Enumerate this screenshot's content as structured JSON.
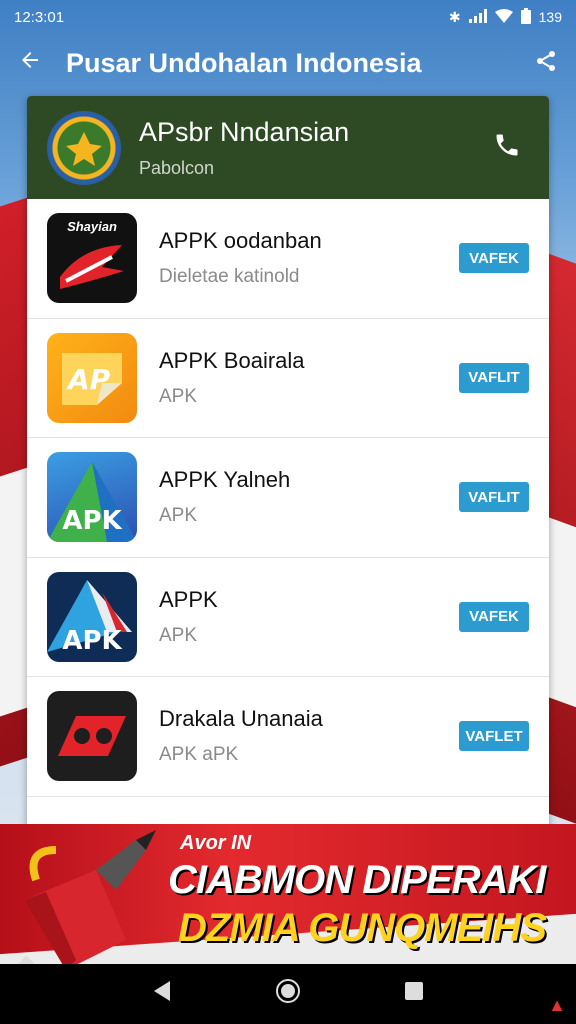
{
  "status_bar": {
    "time": "12:3:01",
    "battery": "139"
  },
  "app_bar": {
    "title": "Pusar Undohalan Indonesia"
  },
  "header": {
    "title": "APsbr Nndansian",
    "subtitle": "Pabolcon"
  },
  "apps": [
    {
      "name": "APPK oodanban",
      "sub": "Dieletae katinold",
      "button": "VAFEK",
      "icon": "logo-red-black",
      "icon_text": "Shayian"
    },
    {
      "name": "APPK Boairala",
      "sub": "APK",
      "button": "VAFLIT",
      "icon": "logo-orange",
      "icon_text": ""
    },
    {
      "name": "APPK Yalneh",
      "sub": "APK",
      "button": "VAFLIT",
      "icon": "logo-blue-apk",
      "icon_text": "APK"
    },
    {
      "name": "APPK",
      "sub": "APK",
      "button": "VAFEK",
      "icon": "logo-navy-apk",
      "icon_text": "APK"
    },
    {
      "name": "Drakala Unanaia",
      "sub": "APK aPK",
      "button": "VAFLET",
      "icon": "logo-black-red",
      "icon_text": ""
    }
  ],
  "banner": {
    "top": "Avor IN",
    "line1": "CIABMON DIPERAKI",
    "line2": "DZMIA GUNQMEIHS"
  },
  "colors": {
    "header_bg": "#2e4a24",
    "install_button": "#2c9bd0",
    "banner_red": "#d21f27",
    "banner_yellow": "#ffd21e"
  }
}
